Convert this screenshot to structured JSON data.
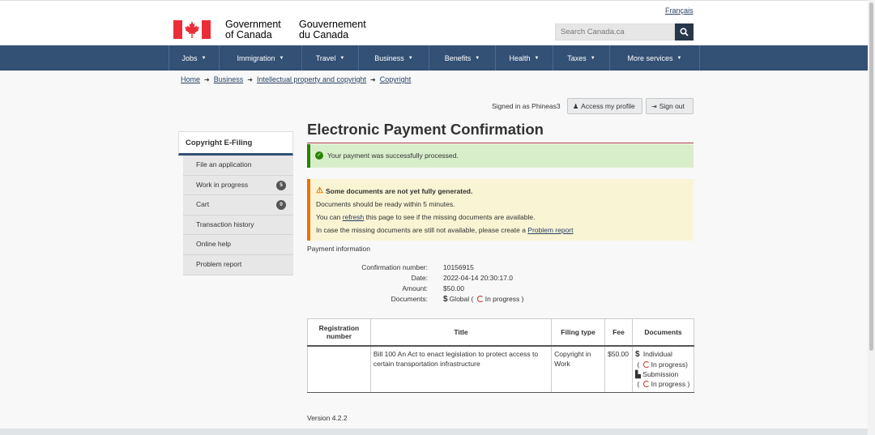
{
  "header": {
    "gov_en_1": "Government",
    "gov_en_2": "of Canada",
    "gov_fr_1": "Gouvernement",
    "gov_fr_2": "du Canada",
    "language_link": "Français",
    "search_placeholder": "Search Canada.ca"
  },
  "nav": [
    "Jobs",
    "Immigration",
    "Travel",
    "Business",
    "Benefits",
    "Health",
    "Taxes",
    "More services"
  ],
  "breadcrumb": [
    "Home",
    "Business",
    "Intellectual property and copyright",
    "Copyright"
  ],
  "account": {
    "signed_in": "Signed in as Phineas3",
    "profile_btn": "Access my profile",
    "signout_btn": "Sign out"
  },
  "sidebar": {
    "title": "Copyright E-Filing",
    "items": [
      {
        "label": "File an application",
        "badge": null
      },
      {
        "label": "Work in progress",
        "badge": "5"
      },
      {
        "label": "Cart",
        "badge": "0"
      },
      {
        "label": "Transaction history",
        "badge": null
      },
      {
        "label": "Online help",
        "badge": null
      },
      {
        "label": "Problem report",
        "badge": null
      }
    ]
  },
  "page": {
    "title": "Electronic Payment Confirmation",
    "success": "Your payment was successfully processed.",
    "warning": {
      "title": "Some documents are not yet fully generated.",
      "line1": "Documents should be ready within 5 minutes.",
      "line2_pre": "You can ",
      "line2_link": "refresh",
      "line2_post": " this page to see if the missing documents are available.",
      "line3_pre": "In case the missing documents are still not available, please create a ",
      "line3_link": "Problem report"
    },
    "payment_heading": "Payment information",
    "payment": {
      "confirmation_label": "Confirmation number:",
      "confirmation_value": "10156915",
      "date_label": "Date:",
      "date_value": "2022-04-14 20:30:17.0",
      "amount_label": "Amount:",
      "amount_value": "$50.00",
      "documents_label": "Documents:",
      "documents_name": "Global (",
      "documents_status": "In progress )"
    },
    "version": "Version 4.2.2"
  },
  "table": {
    "headers": [
      "Registration number",
      "Title",
      "Filing type",
      "Fee",
      "Documents"
    ],
    "row": {
      "reg": "",
      "title": "Bill 100 An Act to enact legislation to protect access to certain transportation infrastructure",
      "type": "Copyright in Work",
      "fee": "$50.00",
      "doc1": "Individual",
      "doc1_status_pre": "(",
      "doc1_status": "In progress)",
      "doc2": "Submission",
      "doc2_status_pre": "(",
      "doc2_status": "In progress )"
    }
  },
  "colors": {
    "nav": "#335075",
    "success": "#278400",
    "warning": "#ee7100",
    "flag_red": "#eb2d37"
  }
}
